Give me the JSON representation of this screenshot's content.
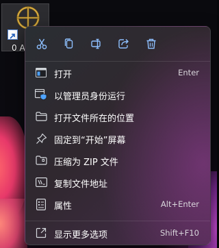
{
  "desktop_icon": {
    "label": "0 A",
    "icon": "crosshair-target-icon"
  },
  "context_menu": {
    "toolbar": [
      {
        "icon": "cut-icon",
        "name": "cut-button"
      },
      {
        "icon": "copy-icon",
        "name": "copy-button"
      },
      {
        "icon": "rename-icon",
        "name": "rename-button"
      },
      {
        "icon": "share-icon",
        "name": "share-button"
      },
      {
        "icon": "delete-icon",
        "name": "delete-button"
      }
    ],
    "items": [
      {
        "label": "打开",
        "shortcut": "Enter",
        "icon": "open-app-icon"
      },
      {
        "label": "以管理员身份运行",
        "shortcut": "",
        "icon": "shield-admin-icon"
      },
      {
        "label": "打开文件所在的位置",
        "shortcut": "",
        "icon": "folder-icon"
      },
      {
        "label": "固定到“开始”屏幕",
        "shortcut": "",
        "icon": "pin-icon"
      },
      {
        "label": "压缩为 ZIP 文件",
        "shortcut": "",
        "icon": "zip-folder-icon"
      },
      {
        "label": "复制文件地址",
        "shortcut": "",
        "icon": "copy-path-icon"
      },
      {
        "label": "属性",
        "shortcut": "Alt+Enter",
        "icon": "properties-icon"
      }
    ],
    "more_options": {
      "label": "显示更多选项",
      "shortcut": "Shift+F10",
      "icon": "more-options-icon"
    }
  },
  "colors": {
    "accent_blue": "#4fa3ff",
    "menu_text": "#ffffff",
    "shortcut_text": "#d9d6dc"
  }
}
